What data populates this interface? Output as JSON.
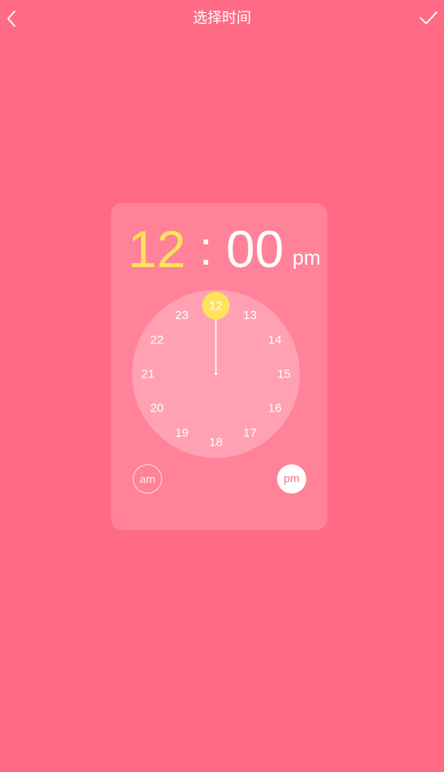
{
  "header": {
    "title": "选择时间",
    "back_icon": "chevron-left-icon",
    "confirm_icon": "check-icon"
  },
  "time": {
    "hour": "12",
    "separator": ":",
    "minute": "00",
    "meridiem": "pm"
  },
  "clock": {
    "numbers": [
      "12",
      "13",
      "14",
      "15",
      "16",
      "17",
      "18",
      "19",
      "20",
      "21",
      "22",
      "23"
    ],
    "selected": "12"
  },
  "period": {
    "am_label": "am",
    "pm_label": "pm",
    "selected": "pm"
  },
  "colors": {
    "background": "#FF6B85",
    "accent": "#FFE35B",
    "text": "#FFFFFF"
  }
}
